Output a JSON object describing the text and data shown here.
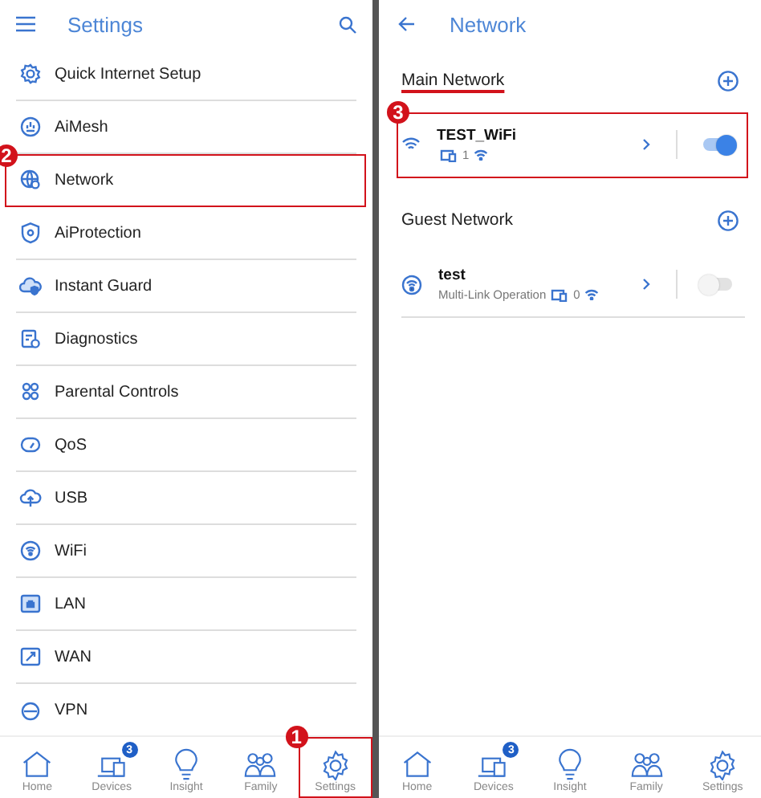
{
  "settings_screen": {
    "title": "Settings",
    "items": [
      {
        "label": "Quick Internet Setup"
      },
      {
        "label": "AiMesh"
      },
      {
        "label": "Network",
        "callout": "2"
      },
      {
        "label": "AiProtection"
      },
      {
        "label": "Instant Guard"
      },
      {
        "label": "Diagnostics"
      },
      {
        "label": "Parental Controls"
      },
      {
        "label": "QoS"
      },
      {
        "label": "USB"
      },
      {
        "label": "WiFi"
      },
      {
        "label": "LAN"
      },
      {
        "label": "WAN"
      },
      {
        "label": "VPN"
      }
    ],
    "bottom_nav": [
      {
        "label": "Home"
      },
      {
        "label": "Devices",
        "badge": "3"
      },
      {
        "label": "Insight"
      },
      {
        "label": "Family"
      },
      {
        "label": "Settings",
        "callout": "1"
      }
    ]
  },
  "network_screen": {
    "title": "Network",
    "sections": [
      {
        "title": "Main Network",
        "underlined": true,
        "networks": [
          {
            "kind": "wifi",
            "name": "TEST_WiFi",
            "device_count": "1",
            "on": true,
            "callout": "3"
          }
        ]
      },
      {
        "title": "Guest Network",
        "underlined": false,
        "networks": [
          {
            "kind": "mlo",
            "name": "test",
            "subtitle": "Multi-Link Operation",
            "device_count": "0",
            "on": false
          }
        ]
      }
    ],
    "bottom_nav": [
      {
        "label": "Home"
      },
      {
        "label": "Devices",
        "badge": "3"
      },
      {
        "label": "Insight"
      },
      {
        "label": "Family"
      },
      {
        "label": "Settings"
      }
    ]
  }
}
